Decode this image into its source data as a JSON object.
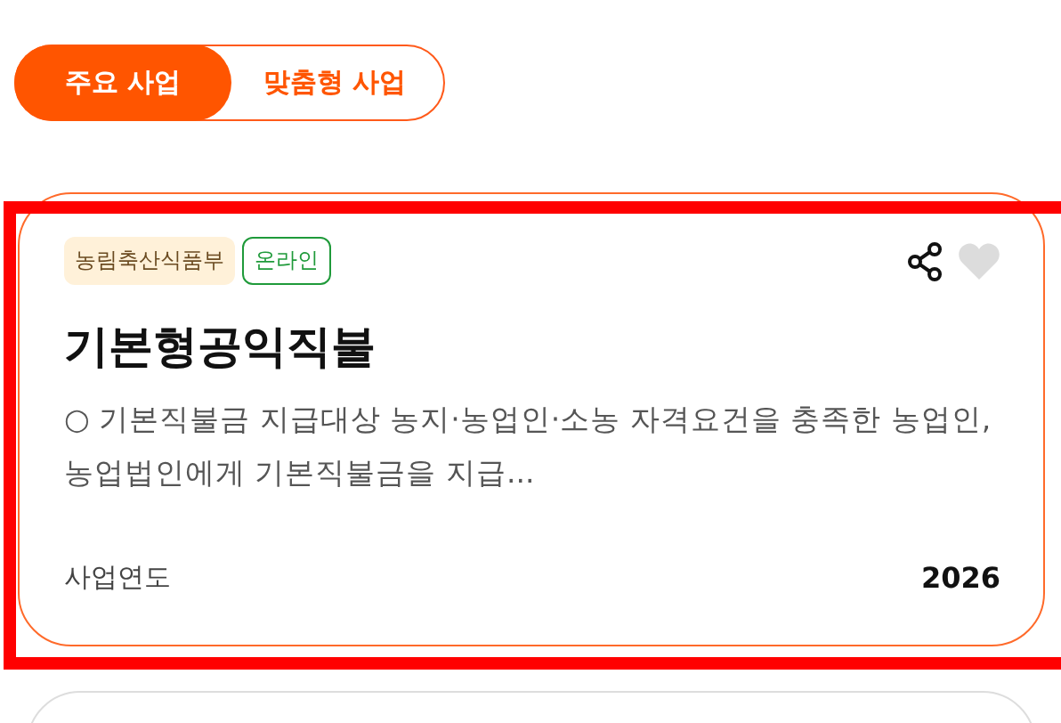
{
  "tabs": [
    {
      "label": "주요 사업",
      "selected": true
    },
    {
      "label": "맞춤형 사업",
      "selected": false
    }
  ],
  "cards": [
    {
      "tags": [
        {
          "kind": "ministry",
          "label": "농림축산식품부"
        },
        {
          "kind": "online",
          "label": "온라인"
        }
      ],
      "liked": false,
      "highlighted": true,
      "title": "기본형공익직불",
      "description": "○ 기본직불금 지급대상 농지·농업인·소농 자격요건을 충족한 농업인, 농업법인에게 기본직불금을 지급...",
      "footer_label": "사업연도",
      "footer_value": "2026"
    }
  ]
}
